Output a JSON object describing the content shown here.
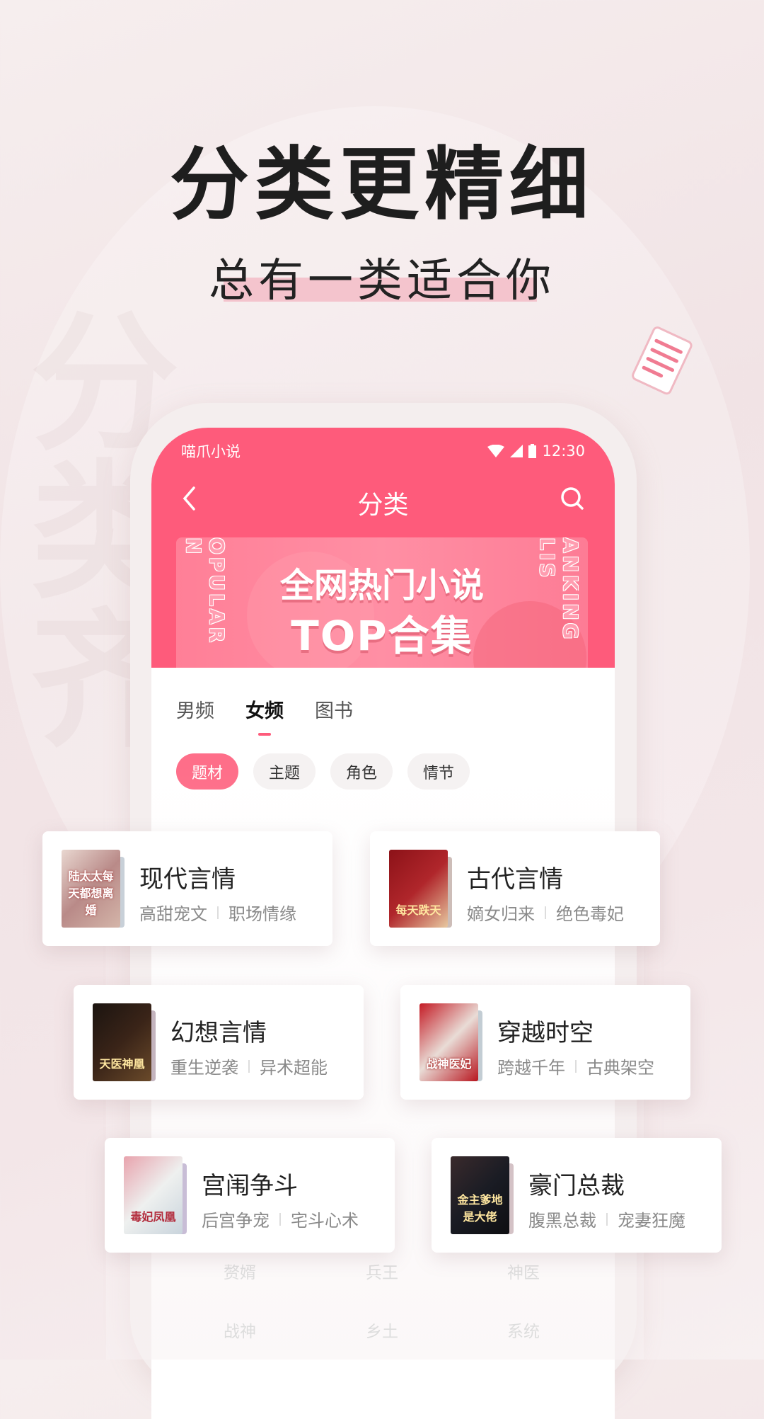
{
  "headline": "分类更精细",
  "subheadline": "总有一类适合你",
  "watermark": "分类齐",
  "status": {
    "app_name": "喵爪小说",
    "time": "12:30"
  },
  "nav": {
    "title": "分类",
    "back_icon": "chevron-left-icon",
    "search_icon": "search-icon"
  },
  "banner": {
    "line1": "全网热门小说",
    "line2": "TOP合集",
    "left_vertical": "OPULAR N",
    "right_vertical": "ANKING LIS"
  },
  "tabs": [
    {
      "label": "男频"
    },
    {
      "label": "女频",
      "active": true
    },
    {
      "label": "图书"
    }
  ],
  "chips": [
    {
      "label": "题材",
      "active": true
    },
    {
      "label": "主题"
    },
    {
      "label": "角色"
    },
    {
      "label": "情节"
    }
  ],
  "cards": [
    {
      "title": "现代言情",
      "tags": [
        "高甜宠文",
        "职场情缘"
      ],
      "cover_text": "陆太太每天都想离婚"
    },
    {
      "title": "古代言情",
      "tags": [
        "嫡女归来",
        "绝色毒妃"
      ],
      "cover_text": "每天跌天"
    },
    {
      "title": "幻想言情",
      "tags": [
        "重生逆袭",
        "异术超能"
      ],
      "cover_text": "天医神凰"
    },
    {
      "title": "穿越时空",
      "tags": [
        "跨越千年",
        "古典架空"
      ],
      "cover_text": "战神医妃"
    },
    {
      "title": "宫闱争斗",
      "tags": [
        "后宫争宠",
        "宅斗心术"
      ],
      "cover_text": "毒妃凤凰"
    },
    {
      "title": "豪门总裁",
      "tags": [
        "腹黑总裁",
        "宠妻狂魔"
      ],
      "cover_text": "金主爹地是大佬"
    }
  ],
  "background_grid": [
    [
      "赘婿",
      "兵王",
      "神医"
    ],
    [
      "战神",
      "乡土",
      "系统"
    ]
  ],
  "colors": {
    "brand": "#fe5b7b",
    "chip_active": "#fe6e89",
    "highlight": "#f4c4cd"
  }
}
